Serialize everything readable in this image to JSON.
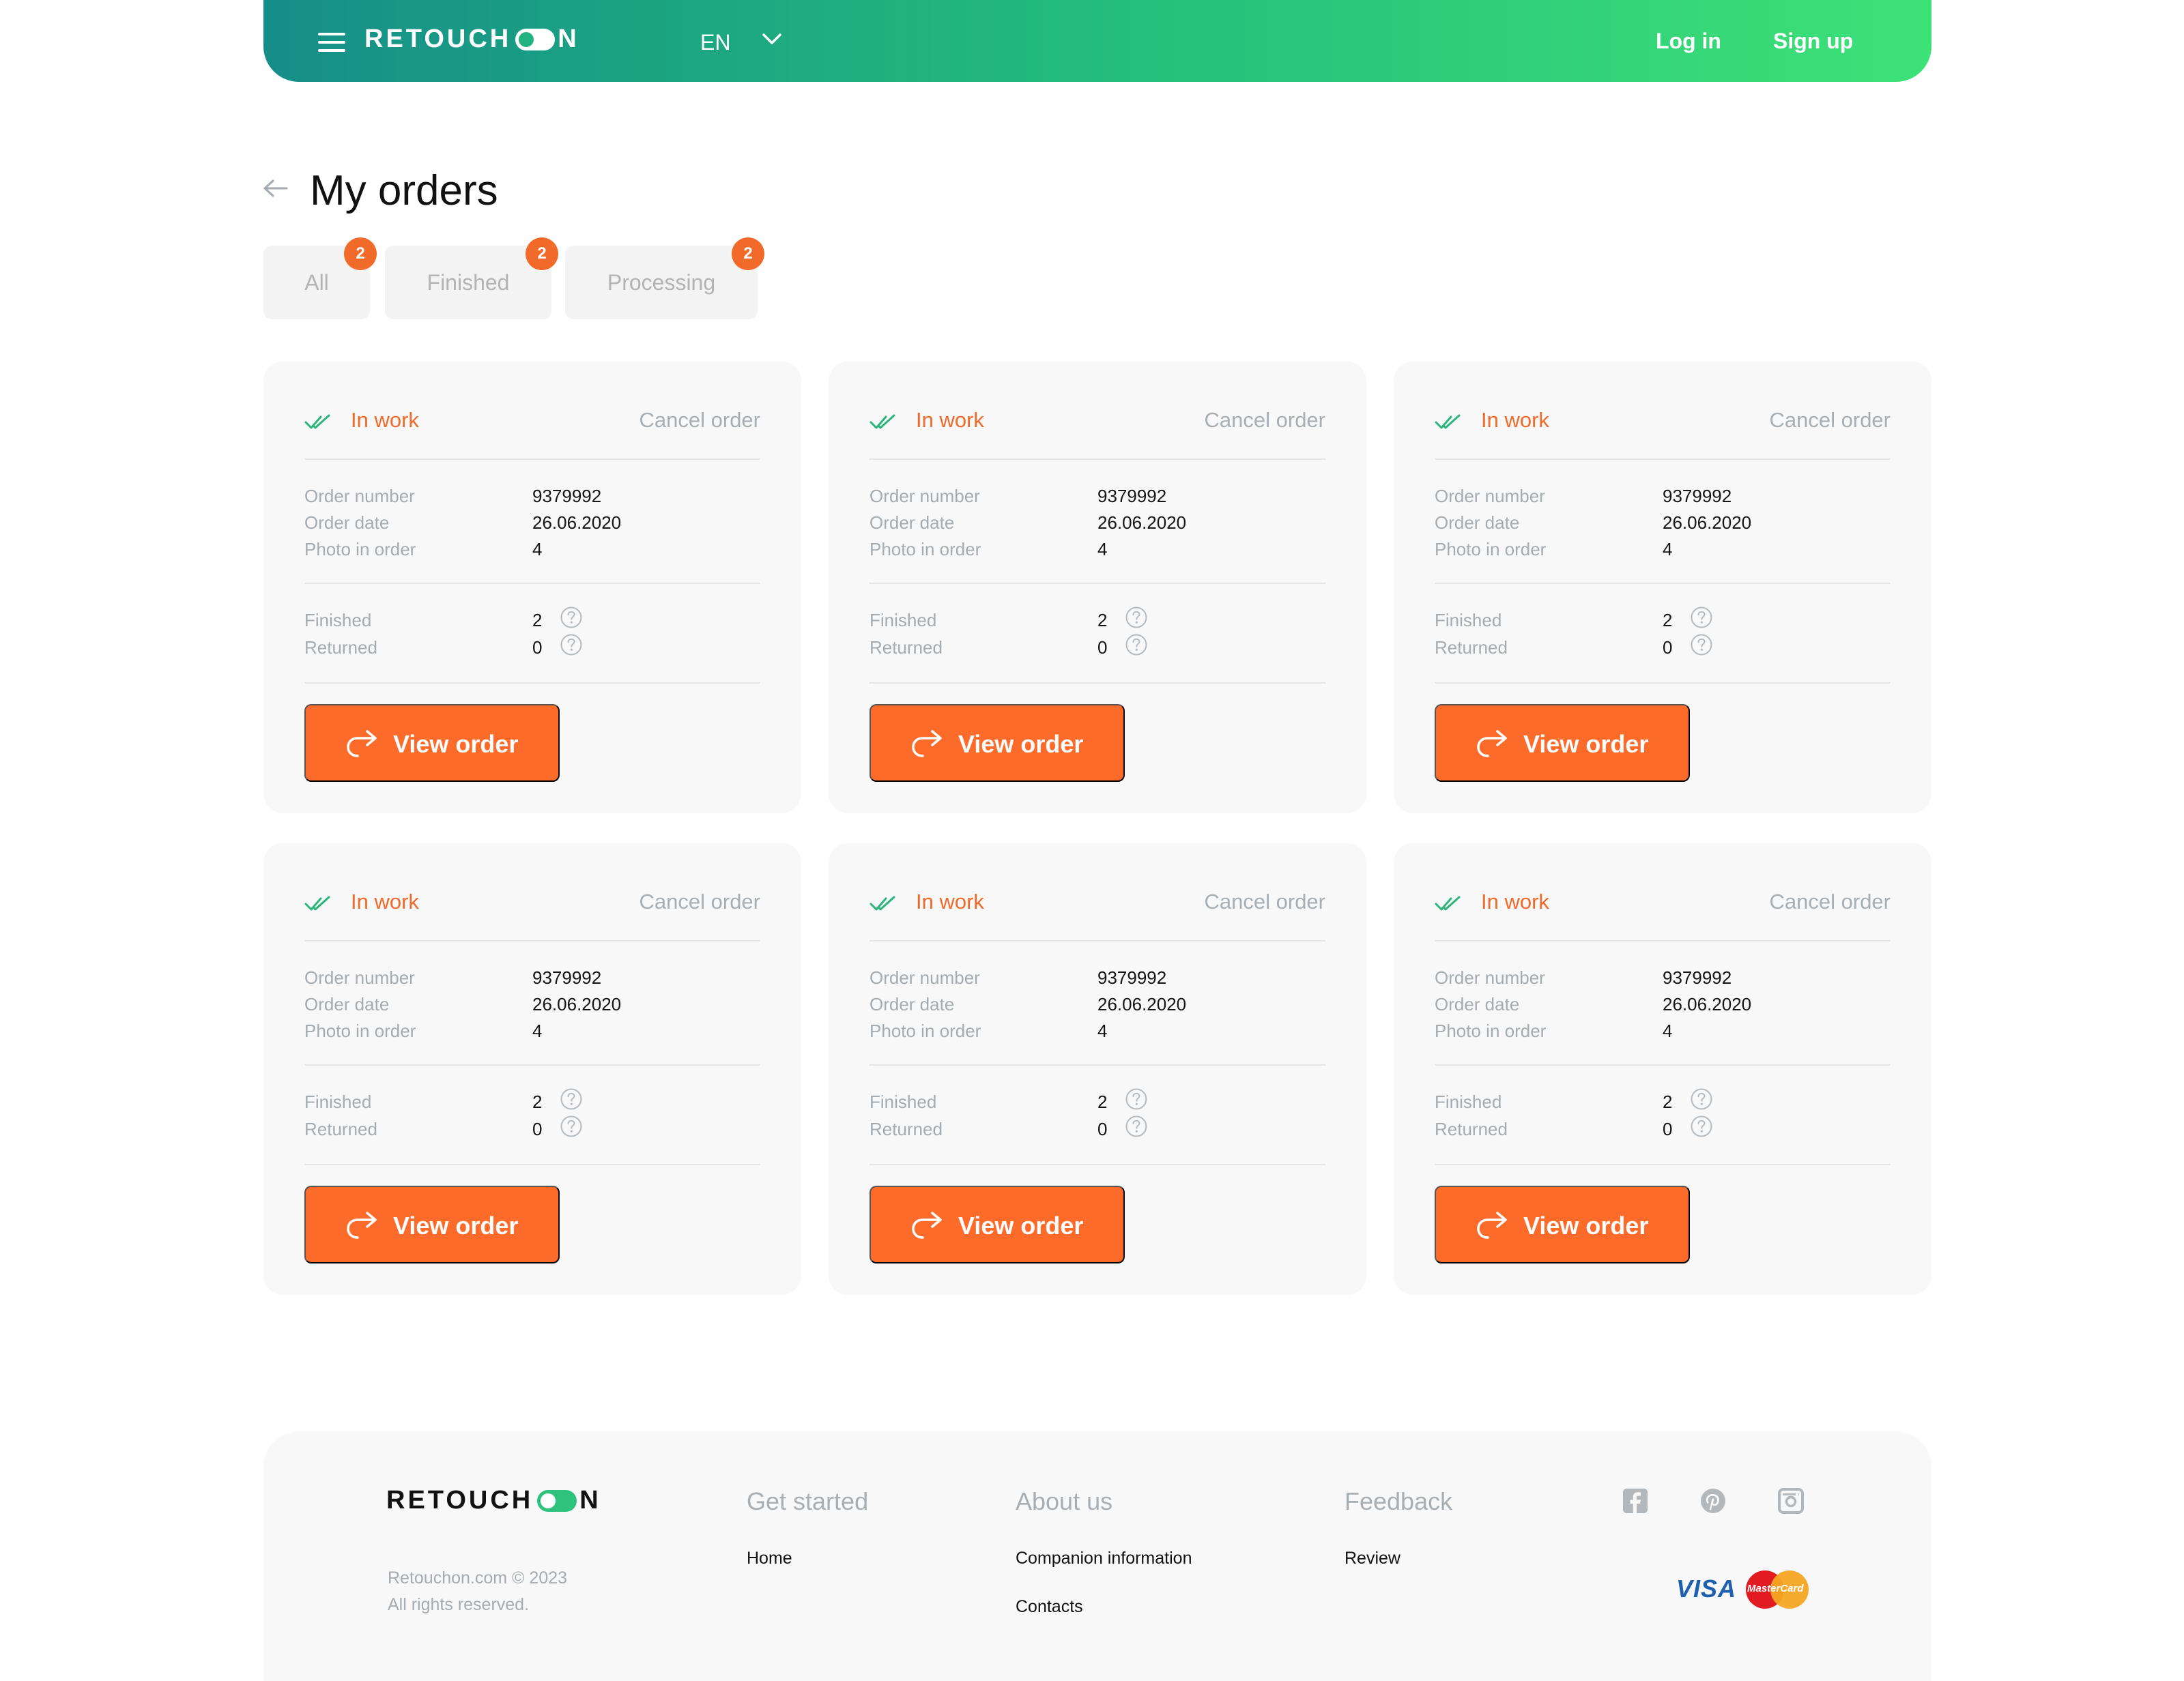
{
  "brand": {
    "logo_left": "RETOUCH",
    "logo_right": "N",
    "accent_color": "#fd6b2a",
    "gradient_start": "#168e88",
    "gradient_end": "#3de277"
  },
  "header": {
    "language": "EN",
    "login": "Log in",
    "signup": "Sign up"
  },
  "page": {
    "title": "My orders"
  },
  "tabs": [
    {
      "label": "All",
      "count": "2"
    },
    {
      "label": "Finished",
      "count": "2"
    },
    {
      "label": "Processing",
      "count": "2"
    }
  ],
  "orders": [
    {
      "status": "In work",
      "cancel": "Cancel order",
      "number_label": "Order number",
      "number": "9379992",
      "date_label": "Order date",
      "date": "26.06.2020",
      "photos_label": "Photo in order",
      "photos": "4",
      "finished_label": "Finished",
      "finished": "2",
      "returned_label": "Returned",
      "returned": "0",
      "button": "View order"
    },
    {
      "status": "In work",
      "cancel": "Cancel order",
      "number_label": "Order number",
      "number": "9379992",
      "date_label": "Order date",
      "date": "26.06.2020",
      "photos_label": "Photo in order",
      "photos": "4",
      "finished_label": "Finished",
      "finished": "2",
      "returned_label": "Returned",
      "returned": "0",
      "button": "View order"
    },
    {
      "status": "In work",
      "cancel": "Cancel order",
      "number_label": "Order number",
      "number": "9379992",
      "date_label": "Order date",
      "date": "26.06.2020",
      "photos_label": "Photo in order",
      "photos": "4",
      "finished_label": "Finished",
      "finished": "2",
      "returned_label": "Returned",
      "returned": "0",
      "button": "View order"
    },
    {
      "status": "In work",
      "cancel": "Cancel order",
      "number_label": "Order number",
      "number": "9379992",
      "date_label": "Order date",
      "date": "26.06.2020",
      "photos_label": "Photo in order",
      "photos": "4",
      "finished_label": "Finished",
      "finished": "2",
      "returned_label": "Returned",
      "returned": "0",
      "button": "View order"
    },
    {
      "status": "In work",
      "cancel": "Cancel order",
      "number_label": "Order number",
      "number": "9379992",
      "date_label": "Order date",
      "date": "26.06.2020",
      "photos_label": "Photo in order",
      "photos": "4",
      "finished_label": "Finished",
      "finished": "2",
      "returned_label": "Returned",
      "returned": "0",
      "button": "View order"
    },
    {
      "status": "In work",
      "cancel": "Cancel order",
      "number_label": "Order number",
      "number": "9379992",
      "date_label": "Order date",
      "date": "26.06.2020",
      "photos_label": "Photo in order",
      "photos": "4",
      "finished_label": "Finished",
      "finished": "2",
      "returned_label": "Returned",
      "returned": "0",
      "button": "View order"
    }
  ],
  "footer": {
    "copyright_line1": "Retouchon.com © 2023",
    "copyright_line2": "All rights reserved.",
    "columns": [
      {
        "title": "Get started",
        "links": [
          "Home"
        ]
      },
      {
        "title": "About us",
        "links": [
          "Companion information",
          "Contacts"
        ]
      },
      {
        "title": "Feedback",
        "links": [
          "Review"
        ]
      }
    ],
    "social_icons": [
      "facebook-icon",
      "pinterest-icon",
      "instagram-icon"
    ],
    "payment": {
      "visa": "VISA",
      "mastercard": "MasterCard"
    }
  }
}
